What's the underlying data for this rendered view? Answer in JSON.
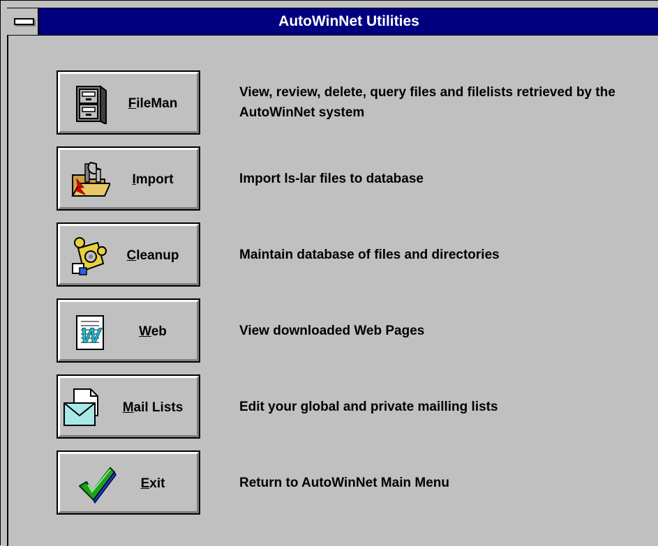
{
  "window": {
    "title": "AutoWinNet Utilities"
  },
  "buttons": [
    {
      "label_underline": "F",
      "label_rest": "ileMan",
      "icon": "file-cabinet-icon",
      "description": "View, review, delete, query files and filelists retrieved by the AutoWinNet system"
    },
    {
      "label_underline": "I",
      "label_rest": "mport",
      "icon": "import-folder-tools-icon",
      "description": "Import ls-lar files to database"
    },
    {
      "label_underline": "C",
      "label_rest": "leanup",
      "icon": "cleanup-person-icon",
      "description": "Maintain database of files and directories"
    },
    {
      "label_underline": "W",
      "label_rest": "eb",
      "icon": "web-page-icon",
      "description": "View downloaded Web Pages"
    },
    {
      "label_underline": "M",
      "label_rest": "ail Lists",
      "icon": "mail-envelope-icon",
      "description": "Edit your global and private mailling lists"
    },
    {
      "label_underline": "E",
      "label_rest": "xit",
      "icon": "checkmark-icon",
      "description": "Return to AutoWinNet Main Menu"
    }
  ]
}
